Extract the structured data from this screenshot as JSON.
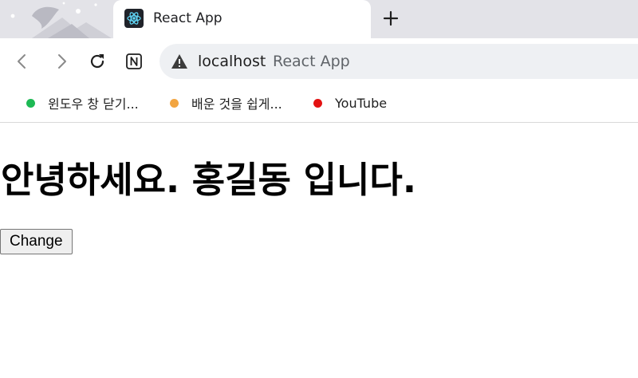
{
  "browser": {
    "tab": {
      "title": "React App",
      "favicon": "react-logo-icon"
    },
    "new_tab_icon": "plus-icon",
    "toolbar": {
      "back_icon": "back-arrow-icon",
      "forward_icon": "forward-arrow-icon",
      "reload_icon": "reload-icon",
      "extension_icon": "notion-icon"
    },
    "address_bar": {
      "security_icon": "warning-triangle-icon",
      "host": "localhost",
      "page_title": "React App"
    },
    "bookmarks": [
      {
        "label": "윈도우 창 닫기...",
        "color": "#1db954"
      },
      {
        "label": "배운 것을 쉽게...",
        "color": "#f2a541"
      },
      {
        "label": "YouTube",
        "color": "#e31212"
      }
    ]
  },
  "page": {
    "heading": "안녕하세요. 홍길동 입니다.",
    "button_label": "Change"
  }
}
